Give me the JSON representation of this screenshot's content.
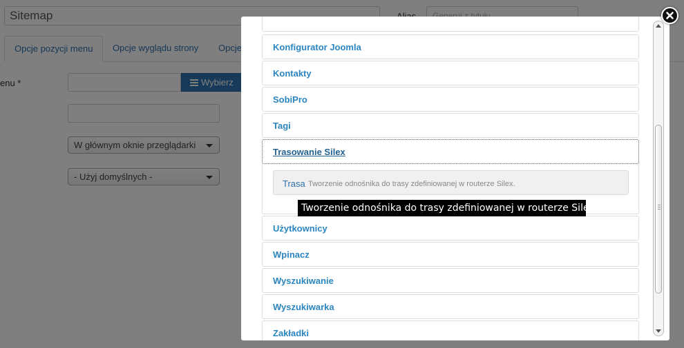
{
  "background": {
    "title_value": "Sitemap",
    "alias_label": "Alias",
    "alias_placeholder": "Generuj z tytułu",
    "tabs": [
      {
        "label": "Opcje pozycji menu"
      },
      {
        "label": "Opcje wyglądu strony"
      },
      {
        "label": "Opcje"
      }
    ],
    "menu_item_label": "enu *",
    "select_button_label": "Wybierz",
    "target_window_value": "W głównym oknie przeglądarki",
    "template_style_value": "- Użyj domyślnych -"
  },
  "modal": {
    "items": [
      {
        "label": "Konfigurator Joomla"
      },
      {
        "label": "Kontakty"
      },
      {
        "label": "SobiPro"
      },
      {
        "label": "Tagi"
      },
      {
        "label": "Trasowanie Silex"
      },
      {
        "label": "Użytkownicy"
      },
      {
        "label": "Wpinacz"
      },
      {
        "label": "Wyszukiwanie"
      },
      {
        "label": "Wyszukiwarka"
      },
      {
        "label": "Zakładki"
      }
    ],
    "sub_item": {
      "label": "Trasa",
      "description": "Tworzenie odnośnika do trasy zdefiniowanej w routerze Silex."
    }
  },
  "tooltip": {
    "text": "Tworzenie odnośnika do trasy zdefiniowanej w routerze Silex."
  },
  "icons": {
    "close": "close-icon",
    "list": "list-icon",
    "caret": "chevron-down-icon"
  },
  "colors": {
    "link_blue": "#2a85c0",
    "button_blue": "#2f73b5",
    "overlay": "#7f7f7f"
  }
}
